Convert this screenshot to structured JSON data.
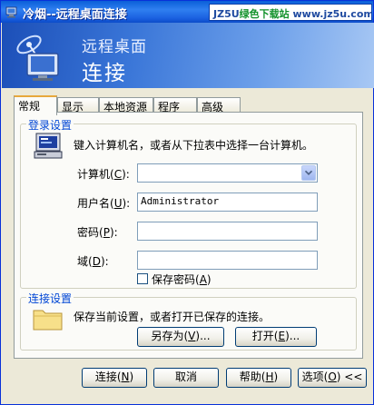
{
  "window": {
    "title": "冷烟--远程桌面连接"
  },
  "watermark": {
    "brand": "JZ5U",
    "green": "绿色下载站",
    "url": "www.jz5u.com"
  },
  "banner": {
    "line1": "远程桌面",
    "line2": "连接"
  },
  "tabs": [
    "常规",
    "显示",
    "本地资源",
    "程序",
    "高级"
  ],
  "login": {
    "group_label": "登录设置",
    "instruction": "键入计算机名，或者从下拉表中选择一台计算机。",
    "computer_label": "计算机",
    "computer_key": "C",
    "computer_value": "",
    "username_label": "用户名",
    "username_key": "U",
    "username_value": "Administrator",
    "password_label": "密码",
    "password_key": "P",
    "password_value": "",
    "domain_label": "域",
    "domain_key": "D",
    "domain_value": "",
    "save_password_label": "保存密码",
    "save_password_key": "A",
    "save_password_checked": false
  },
  "connection": {
    "group_label": "连接设置",
    "instruction": "保存当前设置，或者打开已保存的连接。",
    "save_as": "另存为",
    "save_as_key": "V",
    "open": "打开",
    "open_key": "E"
  },
  "footer": {
    "connect": "连接",
    "connect_key": "N",
    "cancel": "取消",
    "help": "帮助",
    "help_key": "H",
    "options": "选项",
    "options_key": "O",
    "options_suffix": "<<"
  },
  "colors": {
    "titlebar": "#0a5fd8",
    "group_label": "#0046d5",
    "tab_highlight": "#e7a83c"
  }
}
